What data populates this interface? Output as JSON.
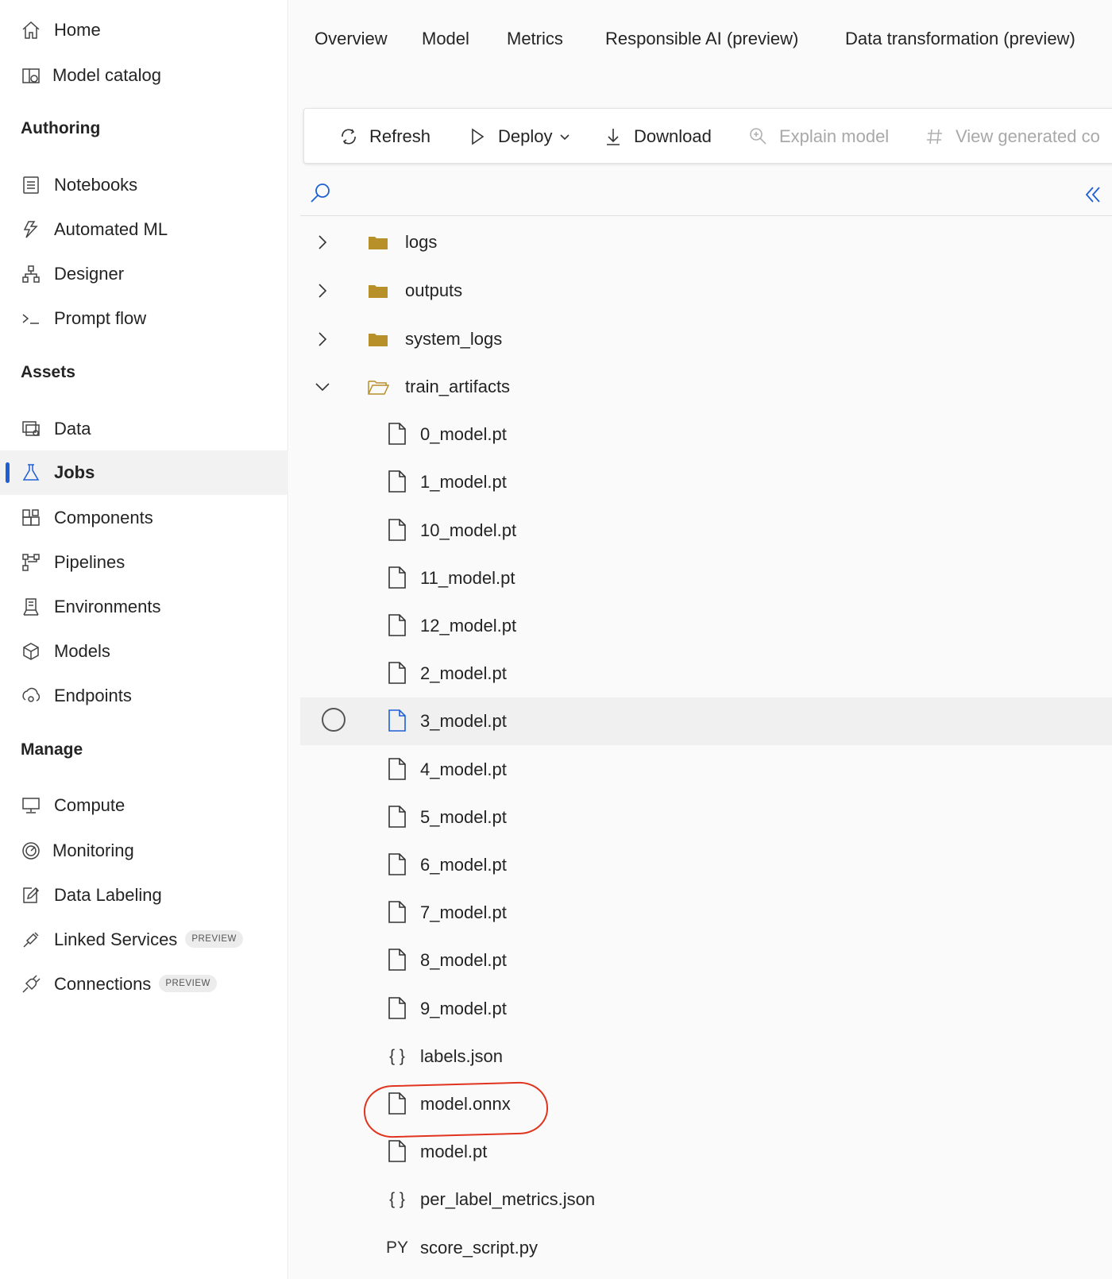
{
  "sidebar": {
    "top_items": [
      {
        "label": "Home",
        "icon": "home-icon"
      },
      {
        "label": "Model catalog",
        "icon": "catalog-icon"
      }
    ],
    "sections": [
      {
        "title": "Authoring",
        "items": [
          {
            "label": "Notebooks",
            "icon": "notebook-icon"
          },
          {
            "label": "Automated ML",
            "icon": "automl-icon"
          },
          {
            "label": "Designer",
            "icon": "designer-icon"
          },
          {
            "label": "Prompt flow",
            "icon": "prompt-flow-icon"
          }
        ]
      },
      {
        "title": "Assets",
        "items": [
          {
            "label": "Data",
            "icon": "data-icon"
          },
          {
            "label": "Jobs",
            "icon": "flask-icon",
            "active": true
          },
          {
            "label": "Components",
            "icon": "components-icon"
          },
          {
            "label": "Pipelines",
            "icon": "pipelines-icon"
          },
          {
            "label": "Environments",
            "icon": "environments-icon"
          },
          {
            "label": "Models",
            "icon": "cube-icon"
          },
          {
            "label": "Endpoints",
            "icon": "endpoints-icon"
          }
        ]
      },
      {
        "title": "Manage",
        "items": [
          {
            "label": "Compute",
            "icon": "compute-icon"
          },
          {
            "label": "Monitoring",
            "icon": "gauge-icon"
          },
          {
            "label": "Data Labeling",
            "icon": "edit-icon"
          },
          {
            "label": "Linked Services",
            "icon": "link-icon",
            "badge": "PREVIEW"
          },
          {
            "label": "Connections",
            "icon": "plug-icon",
            "badge": "PREVIEW"
          }
        ]
      }
    ]
  },
  "tabs": [
    {
      "label": "Overview"
    },
    {
      "label": "Model"
    },
    {
      "label": "Metrics"
    },
    {
      "label": "Responsible AI (preview)"
    },
    {
      "label": "Data transformation (preview)"
    }
  ],
  "toolbar": {
    "refresh": "Refresh",
    "deploy": "Deploy",
    "download": "Download",
    "explain": "Explain model",
    "view_code": "View generated co"
  },
  "tree": {
    "folders": [
      {
        "name": "logs",
        "expanded": false
      },
      {
        "name": "outputs",
        "expanded": false
      },
      {
        "name": "system_logs",
        "expanded": false
      },
      {
        "name": "train_artifacts",
        "expanded": true
      }
    ],
    "files": [
      {
        "name": "0_model.pt",
        "icon": "file-icon"
      },
      {
        "name": "1_model.pt",
        "icon": "file-icon"
      },
      {
        "name": "10_model.pt",
        "icon": "file-icon"
      },
      {
        "name": "11_model.pt",
        "icon": "file-icon"
      },
      {
        "name": "12_model.pt",
        "icon": "file-icon"
      },
      {
        "name": "2_model.pt",
        "icon": "file-icon"
      },
      {
        "name": "3_model.pt",
        "icon": "file-icon",
        "hover": true
      },
      {
        "name": "4_model.pt",
        "icon": "file-icon"
      },
      {
        "name": "5_model.pt",
        "icon": "file-icon"
      },
      {
        "name": "6_model.pt",
        "icon": "file-icon"
      },
      {
        "name": "7_model.pt",
        "icon": "file-icon"
      },
      {
        "name": "8_model.pt",
        "icon": "file-icon"
      },
      {
        "name": "9_model.pt",
        "icon": "file-icon"
      },
      {
        "name": "labels.json",
        "icon": "json-icon",
        "glyph": "{ }"
      },
      {
        "name": "model.onnx",
        "icon": "file-icon",
        "highlighted": true
      },
      {
        "name": "model.pt",
        "icon": "file-icon"
      },
      {
        "name": "per_label_metrics.json",
        "icon": "json-icon",
        "glyph": "{ }"
      },
      {
        "name": "score_script.py",
        "icon": "python-icon",
        "glyph": "PY"
      }
    ]
  },
  "colors": {
    "accent": "#1f5fd6",
    "folder": "#b8902a",
    "annotation": "#e0341f"
  }
}
